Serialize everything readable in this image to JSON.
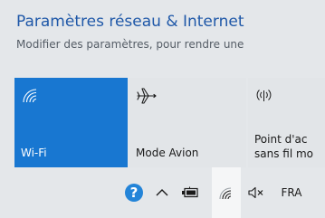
{
  "panel": {
    "title": "Paramètres réseau & Internet",
    "subtitle": "Modifier des paramètres, pour rendre une",
    "tiles": [
      {
        "label": "Wi-Fi",
        "icon": "wifi-icon",
        "active": true
      },
      {
        "label": "Mode Avion",
        "icon": "airplane-icon",
        "active": false
      },
      {
        "label_line1": "Point d'ac",
        "label_line2": "sans fil mo",
        "icon": "hotspot-icon",
        "active": false
      }
    ]
  },
  "taskbar": {
    "items": [
      {
        "icon": "help-icon",
        "glyph": "?"
      },
      {
        "icon": "chevron-up-icon"
      },
      {
        "icon": "battery-icon"
      },
      {
        "icon": "wifi-icon"
      },
      {
        "icon": "volume-muted-icon"
      },
      {
        "label": "FRA"
      }
    ]
  },
  "colors": {
    "accent": "#1877d1",
    "link": "#1f58a8",
    "panel_background": "#e4e7ea",
    "help_icon": "#2384d8"
  }
}
